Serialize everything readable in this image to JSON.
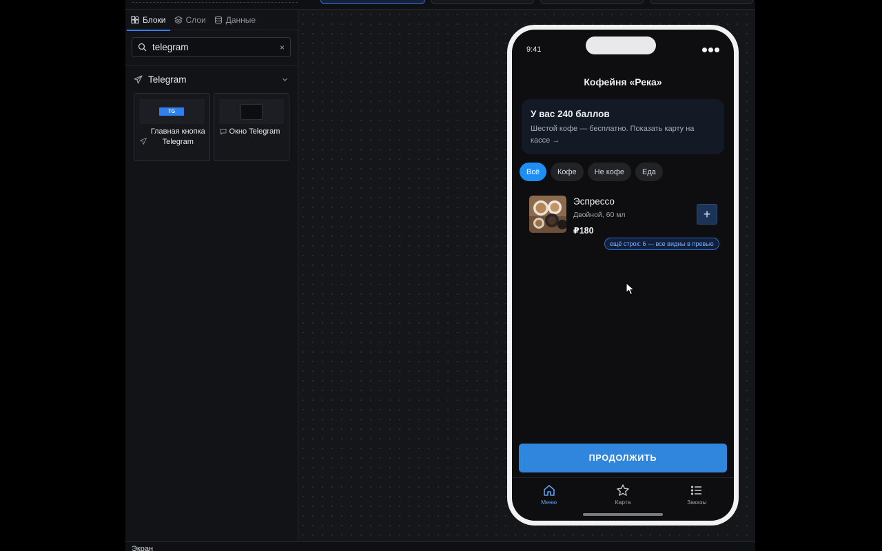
{
  "panel": {
    "tabs": [
      {
        "label": "Блоки",
        "icon": "blocks-icon",
        "active": true
      },
      {
        "label": "Слои",
        "icon": "layers-icon",
        "active": false
      },
      {
        "label": "Данные",
        "icon": "database-icon",
        "active": false
      }
    ],
    "search": {
      "value": "telegram",
      "clear_glyph": "×"
    },
    "section": {
      "title": "Telegram",
      "icon": "telegram-icon",
      "collapsed": false
    },
    "cards": [
      {
        "label": "Главная кнопка Telegram",
        "thumb_text": "TG",
        "icon": "send-icon"
      },
      {
        "label": "Окно Telegram",
        "icon": "chat-icon"
      }
    ]
  },
  "phone": {
    "status_time": "9:41",
    "title": "Кофейня «Река»",
    "loyalty": {
      "title": "У вас 240 баллов",
      "text": "Шестой кофе — бесплатно. Показать карту на кассе →"
    },
    "chips": [
      {
        "label": "Всё",
        "active": true
      },
      {
        "label": "Кофе",
        "active": false
      },
      {
        "label": "Не кофе",
        "active": false
      },
      {
        "label": "Еда",
        "active": false
      }
    ],
    "item": {
      "name": "Эспрессо",
      "desc": "Двойной, 60 мл",
      "price": "₽180",
      "add_glyph": "+"
    },
    "more_rows": "ещё строк: 6 — все видны в превью",
    "cta": "ПРОДОЛЖИТЬ",
    "tabbar": [
      {
        "label": "Меню",
        "icon": "home-icon",
        "active": true
      },
      {
        "label": "Карта",
        "icon": "star-icon",
        "active": false
      },
      {
        "label": "Заказы",
        "icon": "list-icon",
        "active": false
      }
    ]
  },
  "footer": {
    "label": "Экран"
  },
  "colors": {
    "accent": "#2f80ed",
    "cta": "#2f86dc",
    "chip_active": "#1e8ef5"
  }
}
